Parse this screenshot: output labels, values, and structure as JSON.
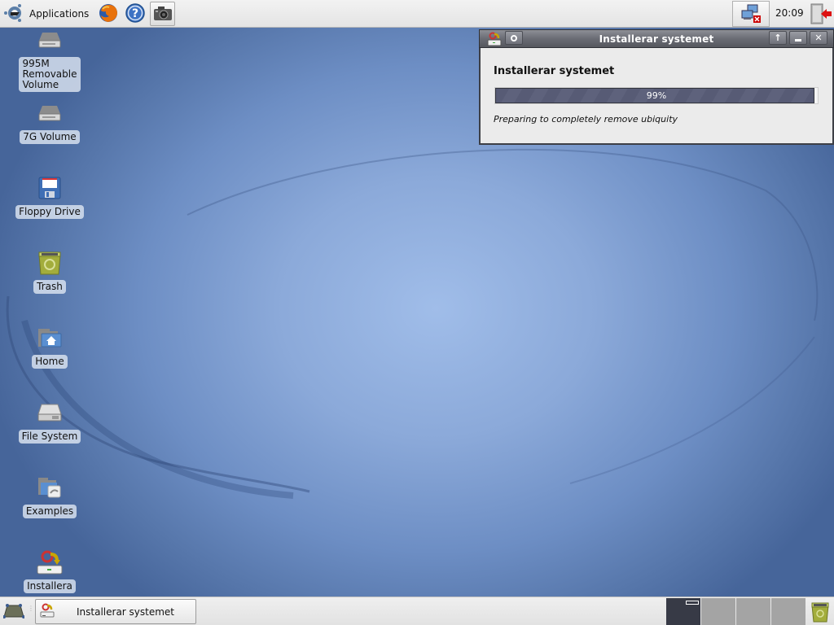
{
  "top_panel": {
    "applications_label": "Applications",
    "launchers": [
      {
        "name": "firefox",
        "icon": "firefox-icon"
      },
      {
        "name": "help",
        "icon": "help-icon"
      },
      {
        "name": "screenshot",
        "icon": "camera-icon"
      }
    ],
    "tray": {
      "network_icon": "network-disconnected-icon"
    },
    "clock": "20:09",
    "logout_icon": "logout-icon"
  },
  "desktop": {
    "icons": [
      {
        "label": "995M\nRemovable\nVolume",
        "icon": "removable-drive-icon"
      },
      {
        "label": "7G Volume",
        "icon": "drive-icon"
      },
      {
        "label": "Floppy Drive",
        "icon": "floppy-icon"
      },
      {
        "label": "Trash",
        "icon": "trash-icon"
      },
      {
        "label": "Home",
        "icon": "home-folder-icon"
      },
      {
        "label": "File System",
        "icon": "harddisk-icon"
      },
      {
        "label": "Examples",
        "icon": "examples-folder-icon"
      },
      {
        "label": "Installera",
        "icon": "installer-icon"
      }
    ]
  },
  "installer_window": {
    "title": "Installerar systemet",
    "heading": "Installerar systemet",
    "progress_percent": 99,
    "progress_text": "99%",
    "status": "Preparing to completely remove ubiquity",
    "buttons": {
      "menu": "○",
      "maximize": "↑",
      "minimize": "_",
      "close": "✕"
    }
  },
  "bottom_panel": {
    "task_label": "Installerar systemet",
    "workspaces": [
      {
        "index": 1,
        "active": true
      },
      {
        "index": 2,
        "active": false
      },
      {
        "index": 3,
        "active": false
      },
      {
        "index": 4,
        "active": false
      }
    ]
  },
  "colors": {
    "titlebar": "#6a6c74",
    "progress_fill": "#575b75",
    "desktop_center": "#a0bde9",
    "desktop_edge": "#46659a",
    "active_workspace": "#373a46"
  }
}
